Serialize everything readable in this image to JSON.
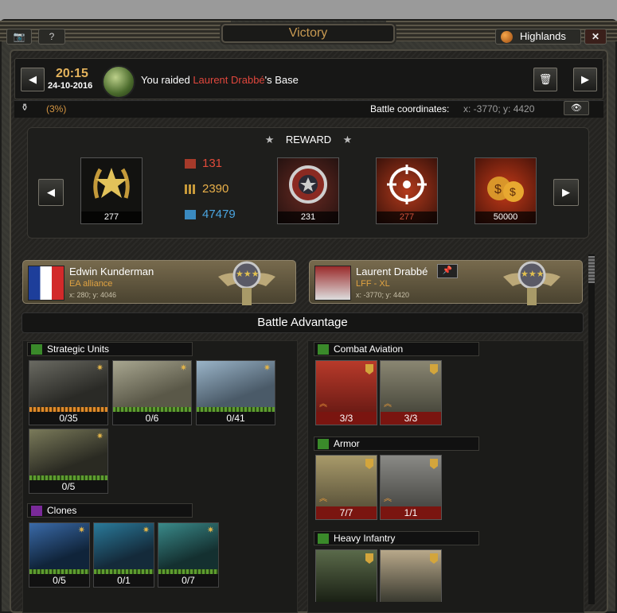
{
  "window": {
    "title": "Victory"
  },
  "titlebar": {
    "camera_icon": "camera-icon",
    "help_label": "?",
    "region_label": "Highlands",
    "close_label": "✕"
  },
  "battle": {
    "time": "20:15",
    "date": "24-10-2016",
    "raid_prefix": "You raided ",
    "raid_target": "Laurent Drabbé",
    "raid_suffix": "'s Base",
    "percent": "(3%)",
    "coords_label": "Battle coordinates:",
    "coords_value": "x: -3770; y: 4420"
  },
  "reward": {
    "title": "REWARD",
    "cards": [
      {
        "icon": "medal-star-icon",
        "value": "277"
      },
      {
        "icon": "rank-badge-icon",
        "value": "231"
      },
      {
        "icon": "target-icon",
        "value": "277"
      },
      {
        "icon": "money-bags-icon",
        "value": "50000"
      }
    ],
    "resources": [
      {
        "icon": "fuel-icon",
        "value": "131",
        "color": "#e04a3a"
      },
      {
        "icon": "ammo-icon",
        "value": "2390",
        "color": "#e9b04a"
      },
      {
        "icon": "metal-icon",
        "value": "47479",
        "color": "#4aa5e0"
      }
    ]
  },
  "players": {
    "left": {
      "name": "Edwin Kunderman",
      "alliance": "EA alliance",
      "coords": "x: 280; y: 4046"
    },
    "right": {
      "name": "Laurent Drabbé",
      "alliance": "LFF - XL",
      "coords": "x: -3770; y: 4420"
    }
  },
  "advantage": {
    "title": "Battle Advantage"
  },
  "left_column": {
    "sections": [
      {
        "title": "Strategic Units",
        "color": "#3a8a2a",
        "units": [
          "0/35",
          "0/6",
          "0/41",
          "0/5"
        ]
      },
      {
        "title": "Clones",
        "color": "#7a2a9a",
        "units": [
          "0/5",
          "0/1",
          "0/7"
        ]
      }
    ]
  },
  "right_column": {
    "sections": [
      {
        "title": "Combat Aviation",
        "units": [
          "3/3",
          "3/3"
        ]
      },
      {
        "title": "Armor",
        "units": [
          "7/7",
          "1/1"
        ]
      },
      {
        "title": "Heavy Infantry",
        "units": []
      }
    ]
  }
}
